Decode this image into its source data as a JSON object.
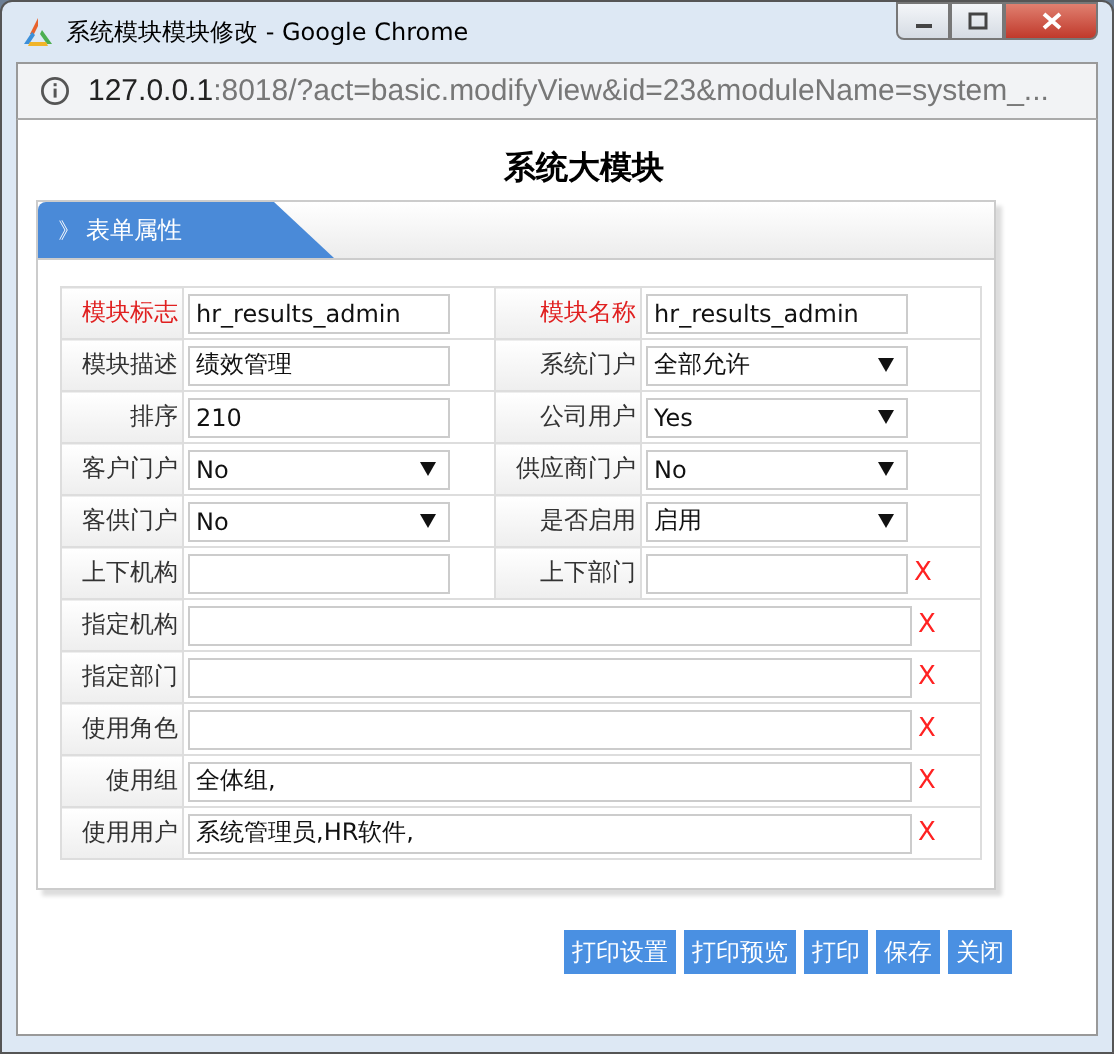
{
  "window": {
    "title": "系统模块模块修改 - Google Chrome"
  },
  "address_bar": {
    "host": "127.0.0.1",
    "rest": ":8018/?act=basic.modifyView&id=23&moduleName=system_..."
  },
  "heading": "系统大模块",
  "panel": {
    "title": "表单属性",
    "toggle": "》"
  },
  "rows": [
    {
      "fields": [
        {
          "label": "模块标志",
          "required": true,
          "kind": "text",
          "value": "hr_results_admin"
        },
        {
          "label": "模块名称",
          "required": true,
          "kind": "text",
          "value": "hr_results_admin"
        }
      ]
    },
    {
      "fields": [
        {
          "label": "模块描述",
          "required": false,
          "kind": "text",
          "value": "绩效管理"
        },
        {
          "label": "系统门户",
          "required": false,
          "kind": "select",
          "value": "全部允许"
        }
      ]
    },
    {
      "fields": [
        {
          "label": "排序",
          "required": false,
          "kind": "text",
          "value": "210"
        },
        {
          "label": "公司用户",
          "required": false,
          "kind": "select",
          "value": "Yes"
        }
      ]
    },
    {
      "fields": [
        {
          "label": "客户门户",
          "required": false,
          "kind": "select",
          "value": "No"
        },
        {
          "label": "供应商门户",
          "required": false,
          "kind": "select",
          "value": "No"
        }
      ]
    },
    {
      "fields": [
        {
          "label": "客供门户",
          "required": false,
          "kind": "select",
          "value": "No"
        },
        {
          "label": "是否启用",
          "required": false,
          "kind": "select",
          "value": "启用"
        }
      ]
    },
    {
      "fields": [
        {
          "label": "上下机构",
          "required": false,
          "kind": "text"
        },
        {
          "label": "上下部门",
          "required": false,
          "kind": "text",
          "clear": "X"
        }
      ]
    },
    {
      "fields": [
        {
          "label": "指定机构",
          "required": false,
          "kind": "text",
          "clear": "X"
        }
      ]
    },
    {
      "fields": [
        {
          "label": "指定部门",
          "required": false,
          "kind": "text",
          "clear": "X"
        }
      ]
    },
    {
      "fields": [
        {
          "label": "使用角色",
          "required": false,
          "kind": "text",
          "clear": "X"
        }
      ]
    },
    {
      "fields": [
        {
          "label": "使用组",
          "required": false,
          "kind": "text",
          "value": "全体组,",
          "clear": "X"
        }
      ]
    },
    {
      "fields": [
        {
          "label": "使用用户",
          "required": false,
          "kind": "text",
          "value": "系统管理员,HR软件,",
          "clear": "X"
        }
      ]
    }
  ],
  "buttons": [
    "打印设置",
    "打印预览",
    "打印",
    "保存",
    "关闭"
  ]
}
